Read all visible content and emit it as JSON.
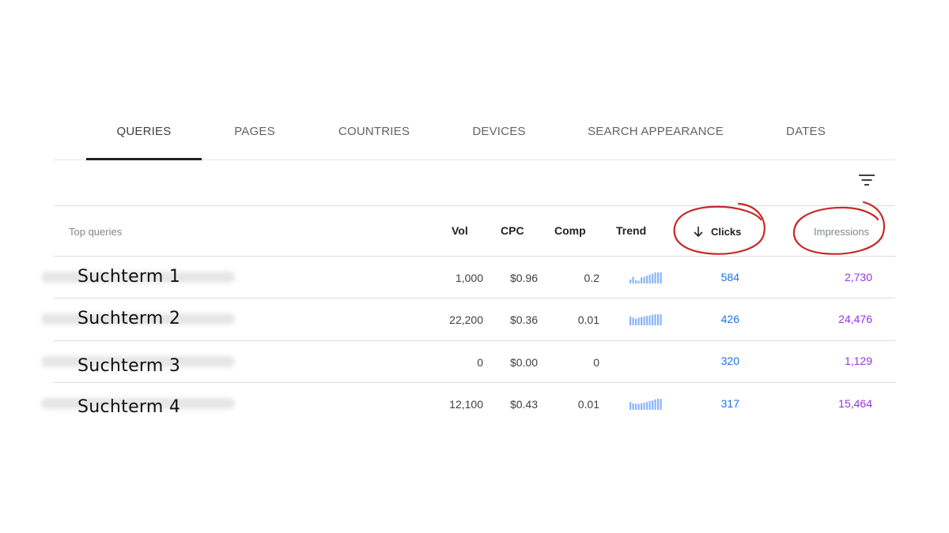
{
  "tabs": [
    {
      "label": "QUERIES",
      "active": true
    },
    {
      "label": "PAGES",
      "active": false
    },
    {
      "label": "COUNTRIES",
      "active": false
    },
    {
      "label": "DEVICES",
      "active": false
    },
    {
      "label": "SEARCH APPEARANCE",
      "active": false
    },
    {
      "label": "DATES",
      "active": false
    }
  ],
  "toolbar": {
    "filter_icon": "filter-icon"
  },
  "table": {
    "headers": {
      "query": "Top queries",
      "vol": "Vol",
      "cpc": "CPC",
      "comp": "Comp",
      "trend": "Trend",
      "clicks": "Clicks",
      "impressions": "Impressions"
    },
    "sort_column": "clicks",
    "sort_direction": "descending",
    "rows": [
      {
        "query": "Suchterm 1",
        "vol": "1,000",
        "cpc": "$0.96",
        "comp": "0.2",
        "trend": [
          0.35,
          0.6,
          0.3,
          0.25,
          0.55,
          0.6,
          0.7,
          0.8,
          0.9,
          1.0,
          1.0,
          1.0
        ],
        "clicks": "584",
        "impressions": "2,730"
      },
      {
        "query": "Suchterm 2",
        "vol": "22,200",
        "cpc": "$0.36",
        "comp": "0.01",
        "trend": [
          0.8,
          0.7,
          0.6,
          0.7,
          0.75,
          0.8,
          0.85,
          0.9,
          0.95,
          1.0,
          1.0,
          1.0
        ],
        "clicks": "426",
        "impressions": "24,476"
      },
      {
        "query": "Suchterm 3",
        "vol": "0",
        "cpc": "$0.00",
        "comp": "0",
        "trend": [],
        "clicks": "320",
        "impressions": "1,129"
      },
      {
        "query": "Suchterm 4",
        "vol": "12,100",
        "cpc": "$0.43",
        "comp": "0.01",
        "trend": [
          0.7,
          0.6,
          0.55,
          0.55,
          0.6,
          0.65,
          0.7,
          0.8,
          0.85,
          0.95,
          1.0,
          1.0
        ],
        "clicks": "317",
        "impressions": "15,464"
      }
    ]
  },
  "colors": {
    "clicks": "#1a73e8",
    "impressions": "#9334e6",
    "trend_bars": "#8ab4f8",
    "annotation": "#c62828"
  }
}
